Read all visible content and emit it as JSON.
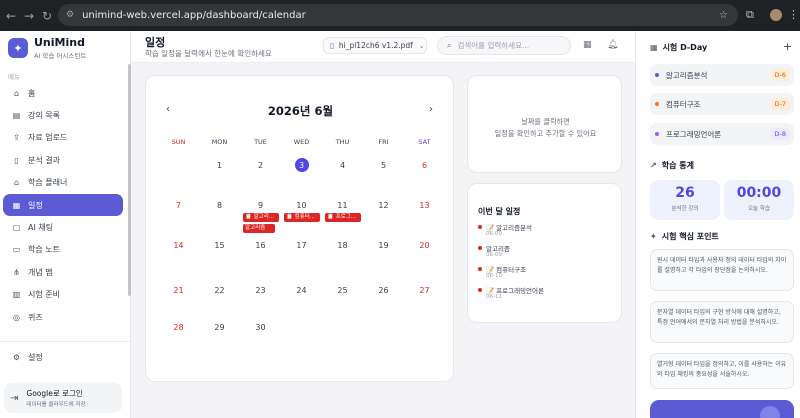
{
  "browser": {
    "url": "unimind-web.vercel.app/dashboard/calendar"
  },
  "brand": {
    "name": "UniMind",
    "subtitle": "AI 학습 어시스턴트"
  },
  "sidebar": {
    "menu_heading": "메뉴",
    "items": [
      {
        "label": "홈",
        "icon": "home-icon"
      },
      {
        "label": "강의 목록",
        "icon": "list-icon"
      },
      {
        "label": "자료 업로드",
        "icon": "upload-icon"
      },
      {
        "label": "분석 결과",
        "icon": "document-icon"
      },
      {
        "label": "학습 플래너",
        "icon": "graduation-cap-icon"
      },
      {
        "label": "일정",
        "icon": "calendar-icon",
        "active": true
      },
      {
        "label": "AI 채팅",
        "icon": "chat-icon"
      },
      {
        "label": "학습 노트",
        "icon": "note-icon"
      },
      {
        "label": "개념 맵",
        "icon": "network-icon"
      },
      {
        "label": "시험 준비",
        "icon": "book-icon"
      },
      {
        "label": "퀴즈",
        "icon": "target-icon"
      }
    ],
    "settings_label": "설정",
    "login": {
      "title": "Google로 로그인",
      "subtitle": "데이터를 클라우드에 저장"
    }
  },
  "header": {
    "title": "일정",
    "subtitle": "학습 일정을 달력에서 한눈에 확인하세요",
    "file_select": "hi_pl12ch6 v1.2.pdf",
    "search_placeholder": "검색어를 입력하세요..."
  },
  "calendar": {
    "month_title": "2026년 6월",
    "weekdays": [
      "SUN",
      "MON",
      "TUE",
      "WED",
      "THU",
      "FRI",
      "SAT"
    ],
    "weeks": [
      [
        "",
        "1",
        "2",
        "3",
        "4",
        "5",
        "6"
      ],
      [
        "7",
        "8",
        "9",
        "10",
        "11",
        "12",
        "13"
      ],
      [
        "14",
        "15",
        "16",
        "17",
        "18",
        "19",
        "20"
      ],
      [
        "21",
        "22",
        "23",
        "24",
        "25",
        "26",
        "27"
      ],
      [
        "28",
        "29",
        "30",
        "",
        "",
        "",
        ""
      ]
    ],
    "today": "3",
    "events": [
      {
        "label": "📋 알고리...",
        "day": "9"
      },
      {
        "label": "알고리즘",
        "day": "9"
      },
      {
        "label": "📋 컴퓨터...",
        "day": "10"
      },
      {
        "label": "📋 프로그...",
        "day": "11"
      }
    ],
    "accent_color": "#4f46e5",
    "event_color": "#dc2626"
  },
  "hint": {
    "line1": "날짜를 클릭하면",
    "line2": "일정을 확인하고 추가할 수 있어요"
  },
  "month_events": {
    "title": "이번 달 일정",
    "items": [
      {
        "name": "📝 알고리즘분석",
        "date": "06-09"
      },
      {
        "name": "알고리즘",
        "date": "06-09"
      },
      {
        "name": "📝 컴퓨터구조",
        "date": "06-10"
      },
      {
        "name": "📝 프로그래밍언어론",
        "date": "06-11"
      }
    ]
  },
  "right_panel": {
    "dday_title": "시험 D-Day",
    "dday_items": [
      {
        "name": "알고리즘분석",
        "badge": "D-6",
        "color": "#5b5bd6",
        "badge_bg": "#ffedd5",
        "badge_fg": "#ea580c"
      },
      {
        "name": "컴퓨터구조",
        "badge": "D-7",
        "color": "#f97316",
        "badge_bg": "#ffedd5",
        "badge_fg": "#ea580c"
      },
      {
        "name": "프로그래밍언어론",
        "badge": "D-8",
        "color": "#a855f7",
        "badge_bg": "#ede9fe",
        "badge_fg": "#7c3aed"
      }
    ],
    "stats_title": "학습 통계",
    "stats": [
      {
        "value": "26",
        "label": "분석한 강의"
      },
      {
        "value": "00:00",
        "label": "오늘 학습"
      }
    ],
    "points_title": "시험 핵심 포인트",
    "points": [
      "원시 데이터 타입과 사용자 정의 데이터 타입의 차이를 설명하고 각 타입의 장단점을 논의하시오.",
      "문자열 데이터 타입의 구현 방식에 대해 설명하고, 특정 언어에서의 문자열 처리 방법을 분석하시오.",
      "열거형 데이터 타입을 정의하고, 이를 사용하는 이유와 타입 체킹의 중요성을 서술하시오."
    ]
  }
}
